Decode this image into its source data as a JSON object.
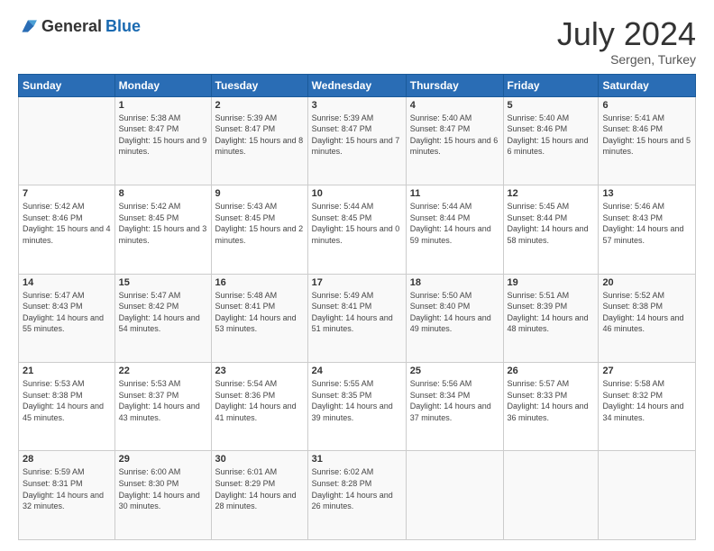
{
  "header": {
    "logo_general": "General",
    "logo_blue": "Blue",
    "month": "July 2024",
    "location": "Sergen, Turkey"
  },
  "days_of_week": [
    "Sunday",
    "Monday",
    "Tuesday",
    "Wednesday",
    "Thursday",
    "Friday",
    "Saturday"
  ],
  "weeks": [
    [
      {
        "day": "",
        "sunrise": "",
        "sunset": "",
        "daylight": ""
      },
      {
        "day": "1",
        "sunrise": "Sunrise: 5:38 AM",
        "sunset": "Sunset: 8:47 PM",
        "daylight": "Daylight: 15 hours and 9 minutes."
      },
      {
        "day": "2",
        "sunrise": "Sunrise: 5:39 AM",
        "sunset": "Sunset: 8:47 PM",
        "daylight": "Daylight: 15 hours and 8 minutes."
      },
      {
        "day": "3",
        "sunrise": "Sunrise: 5:39 AM",
        "sunset": "Sunset: 8:47 PM",
        "daylight": "Daylight: 15 hours and 7 minutes."
      },
      {
        "day": "4",
        "sunrise": "Sunrise: 5:40 AM",
        "sunset": "Sunset: 8:47 PM",
        "daylight": "Daylight: 15 hours and 6 minutes."
      },
      {
        "day": "5",
        "sunrise": "Sunrise: 5:40 AM",
        "sunset": "Sunset: 8:46 PM",
        "daylight": "Daylight: 15 hours and 6 minutes."
      },
      {
        "day": "6",
        "sunrise": "Sunrise: 5:41 AM",
        "sunset": "Sunset: 8:46 PM",
        "daylight": "Daylight: 15 hours and 5 minutes."
      }
    ],
    [
      {
        "day": "7",
        "sunrise": "Sunrise: 5:42 AM",
        "sunset": "Sunset: 8:46 PM",
        "daylight": "Daylight: 15 hours and 4 minutes."
      },
      {
        "day": "8",
        "sunrise": "Sunrise: 5:42 AM",
        "sunset": "Sunset: 8:45 PM",
        "daylight": "Daylight: 15 hours and 3 minutes."
      },
      {
        "day": "9",
        "sunrise": "Sunrise: 5:43 AM",
        "sunset": "Sunset: 8:45 PM",
        "daylight": "Daylight: 15 hours and 2 minutes."
      },
      {
        "day": "10",
        "sunrise": "Sunrise: 5:44 AM",
        "sunset": "Sunset: 8:45 PM",
        "daylight": "Daylight: 15 hours and 0 minutes."
      },
      {
        "day": "11",
        "sunrise": "Sunrise: 5:44 AM",
        "sunset": "Sunset: 8:44 PM",
        "daylight": "Daylight: 14 hours and 59 minutes."
      },
      {
        "day": "12",
        "sunrise": "Sunrise: 5:45 AM",
        "sunset": "Sunset: 8:44 PM",
        "daylight": "Daylight: 14 hours and 58 minutes."
      },
      {
        "day": "13",
        "sunrise": "Sunrise: 5:46 AM",
        "sunset": "Sunset: 8:43 PM",
        "daylight": "Daylight: 14 hours and 57 minutes."
      }
    ],
    [
      {
        "day": "14",
        "sunrise": "Sunrise: 5:47 AM",
        "sunset": "Sunset: 8:43 PM",
        "daylight": "Daylight: 14 hours and 55 minutes."
      },
      {
        "day": "15",
        "sunrise": "Sunrise: 5:47 AM",
        "sunset": "Sunset: 8:42 PM",
        "daylight": "Daylight: 14 hours and 54 minutes."
      },
      {
        "day": "16",
        "sunrise": "Sunrise: 5:48 AM",
        "sunset": "Sunset: 8:41 PM",
        "daylight": "Daylight: 14 hours and 53 minutes."
      },
      {
        "day": "17",
        "sunrise": "Sunrise: 5:49 AM",
        "sunset": "Sunset: 8:41 PM",
        "daylight": "Daylight: 14 hours and 51 minutes."
      },
      {
        "day": "18",
        "sunrise": "Sunrise: 5:50 AM",
        "sunset": "Sunset: 8:40 PM",
        "daylight": "Daylight: 14 hours and 49 minutes."
      },
      {
        "day": "19",
        "sunrise": "Sunrise: 5:51 AM",
        "sunset": "Sunset: 8:39 PM",
        "daylight": "Daylight: 14 hours and 48 minutes."
      },
      {
        "day": "20",
        "sunrise": "Sunrise: 5:52 AM",
        "sunset": "Sunset: 8:38 PM",
        "daylight": "Daylight: 14 hours and 46 minutes."
      }
    ],
    [
      {
        "day": "21",
        "sunrise": "Sunrise: 5:53 AM",
        "sunset": "Sunset: 8:38 PM",
        "daylight": "Daylight: 14 hours and 45 minutes."
      },
      {
        "day": "22",
        "sunrise": "Sunrise: 5:53 AM",
        "sunset": "Sunset: 8:37 PM",
        "daylight": "Daylight: 14 hours and 43 minutes."
      },
      {
        "day": "23",
        "sunrise": "Sunrise: 5:54 AM",
        "sunset": "Sunset: 8:36 PM",
        "daylight": "Daylight: 14 hours and 41 minutes."
      },
      {
        "day": "24",
        "sunrise": "Sunrise: 5:55 AM",
        "sunset": "Sunset: 8:35 PM",
        "daylight": "Daylight: 14 hours and 39 minutes."
      },
      {
        "day": "25",
        "sunrise": "Sunrise: 5:56 AM",
        "sunset": "Sunset: 8:34 PM",
        "daylight": "Daylight: 14 hours and 37 minutes."
      },
      {
        "day": "26",
        "sunrise": "Sunrise: 5:57 AM",
        "sunset": "Sunset: 8:33 PM",
        "daylight": "Daylight: 14 hours and 36 minutes."
      },
      {
        "day": "27",
        "sunrise": "Sunrise: 5:58 AM",
        "sunset": "Sunset: 8:32 PM",
        "daylight": "Daylight: 14 hours and 34 minutes."
      }
    ],
    [
      {
        "day": "28",
        "sunrise": "Sunrise: 5:59 AM",
        "sunset": "Sunset: 8:31 PM",
        "daylight": "Daylight: 14 hours and 32 minutes."
      },
      {
        "day": "29",
        "sunrise": "Sunrise: 6:00 AM",
        "sunset": "Sunset: 8:30 PM",
        "daylight": "Daylight: 14 hours and 30 minutes."
      },
      {
        "day": "30",
        "sunrise": "Sunrise: 6:01 AM",
        "sunset": "Sunset: 8:29 PM",
        "daylight": "Daylight: 14 hours and 28 minutes."
      },
      {
        "day": "31",
        "sunrise": "Sunrise: 6:02 AM",
        "sunset": "Sunset: 8:28 PM",
        "daylight": "Daylight: 14 hours and 26 minutes."
      },
      {
        "day": "",
        "sunrise": "",
        "sunset": "",
        "daylight": ""
      },
      {
        "day": "",
        "sunrise": "",
        "sunset": "",
        "daylight": ""
      },
      {
        "day": "",
        "sunrise": "",
        "sunset": "",
        "daylight": ""
      }
    ]
  ]
}
